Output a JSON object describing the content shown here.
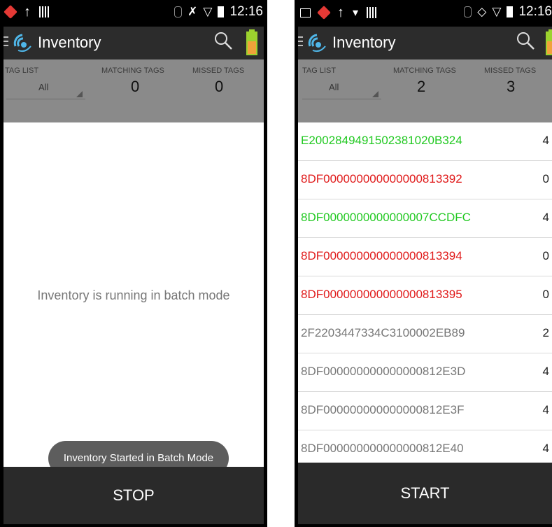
{
  "colors": {
    "match": "#22c922",
    "missed": "#e01a1a",
    "other": "#777777",
    "toolbar": "#2c2c2c",
    "filter_bar": "#8a8a8a"
  },
  "left": {
    "status": {
      "time": "12:16"
    },
    "app_title": "Inventory",
    "filters": {
      "tag_list_label": "TAG LIST",
      "tag_list_value": "All",
      "matching_label": "MATCHING TAGS",
      "matching_value": "0",
      "missed_label": "MISSED TAGS",
      "missed_value": "0"
    },
    "message": "Inventory is running in batch mode",
    "toast": "Inventory Started in Batch Mode",
    "button": "STOP"
  },
  "right": {
    "status": {
      "time": "12:16"
    },
    "app_title": "Inventory",
    "filters": {
      "tag_list_label": "TAG LIST",
      "tag_list_value": "All",
      "matching_label": "MATCHING TAGS",
      "matching_value": "2",
      "missed_label": "MISSED TAGS",
      "missed_value": "3"
    },
    "tags": [
      {
        "id": "E2002849491502381020B324",
        "count": "4",
        "status": "match"
      },
      {
        "id": "8DF000000000000000813392",
        "count": "0",
        "status": "missed"
      },
      {
        "id": "8DF0000000000000007CCDFC",
        "count": "4",
        "status": "match"
      },
      {
        "id": "8DF000000000000000813394",
        "count": "0",
        "status": "missed"
      },
      {
        "id": "8DF000000000000000813395",
        "count": "0",
        "status": "missed"
      },
      {
        "id": "2F2203447334C3100002EB89",
        "count": "2",
        "status": "other"
      },
      {
        "id": "8DF000000000000000812E3D",
        "count": "4",
        "status": "other"
      },
      {
        "id": "8DF000000000000000812E3F",
        "count": "4",
        "status": "other"
      },
      {
        "id": "8DF000000000000000812E40",
        "count": "4",
        "status": "other"
      }
    ],
    "button": "START"
  }
}
